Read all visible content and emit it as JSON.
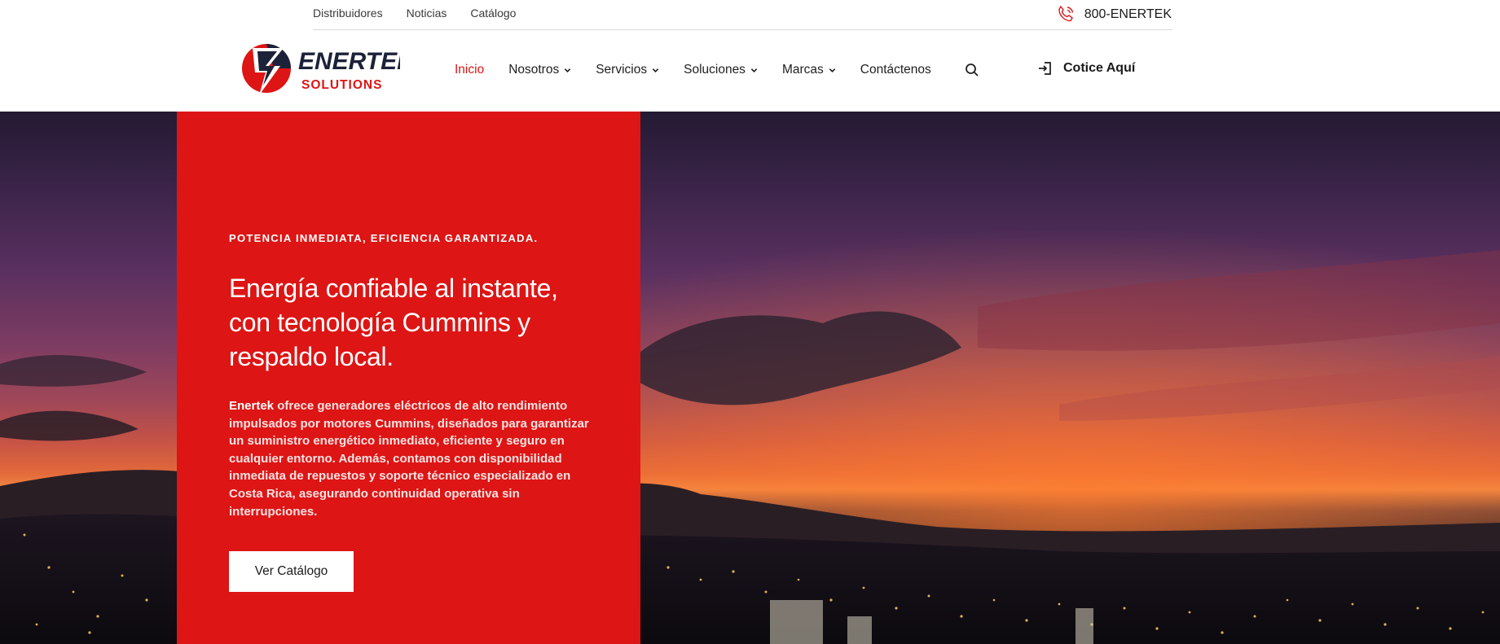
{
  "topbar": {
    "links": [
      "Distribuidores",
      "Noticias",
      "Catálogo"
    ],
    "phone": "800-ENERTEK",
    "phone_icon": "phone-icon"
  },
  "brand": {
    "name": "ENERTEK",
    "tagline": "SOLUTIONS",
    "colors": {
      "red": "#dd1515",
      "navy": "#1c2238"
    }
  },
  "nav": {
    "items": [
      {
        "label": "Inicio",
        "active": true,
        "dropdown": false
      },
      {
        "label": "Nosotros",
        "active": false,
        "dropdown": true
      },
      {
        "label": "Servicios",
        "active": false,
        "dropdown": true
      },
      {
        "label": "Soluciones",
        "active": false,
        "dropdown": true
      },
      {
        "label": "Marcas",
        "active": false,
        "dropdown": true
      },
      {
        "label": "Contáctenos",
        "active": false,
        "dropdown": false
      }
    ],
    "search_icon": "search-icon",
    "cta_label": "Cotice Aquí",
    "cta_icon": "sign-in-icon"
  },
  "hero": {
    "eyebrow": "POTENCIA INMEDIATA, EFICIENCIA GARANTIZADA.",
    "title": "Energía confiable al instante, con tecnología Cummins y respaldo local.",
    "body_strong": "Enertek",
    "body": " ofrece generadores eléctricos de alto rendimiento impulsados por motores Cummins, diseñados para garantizar un suministro energético inmediato, eficiente y seguro en cualquier entorno. Además, contamos con disponibilidad inmediata de repuestos y soporte técnico especializado en Costa Rica, asegurando continuidad operativa sin interrupciones.",
    "button_label": "Ver Catálogo",
    "panel_color": "#dd1515"
  }
}
